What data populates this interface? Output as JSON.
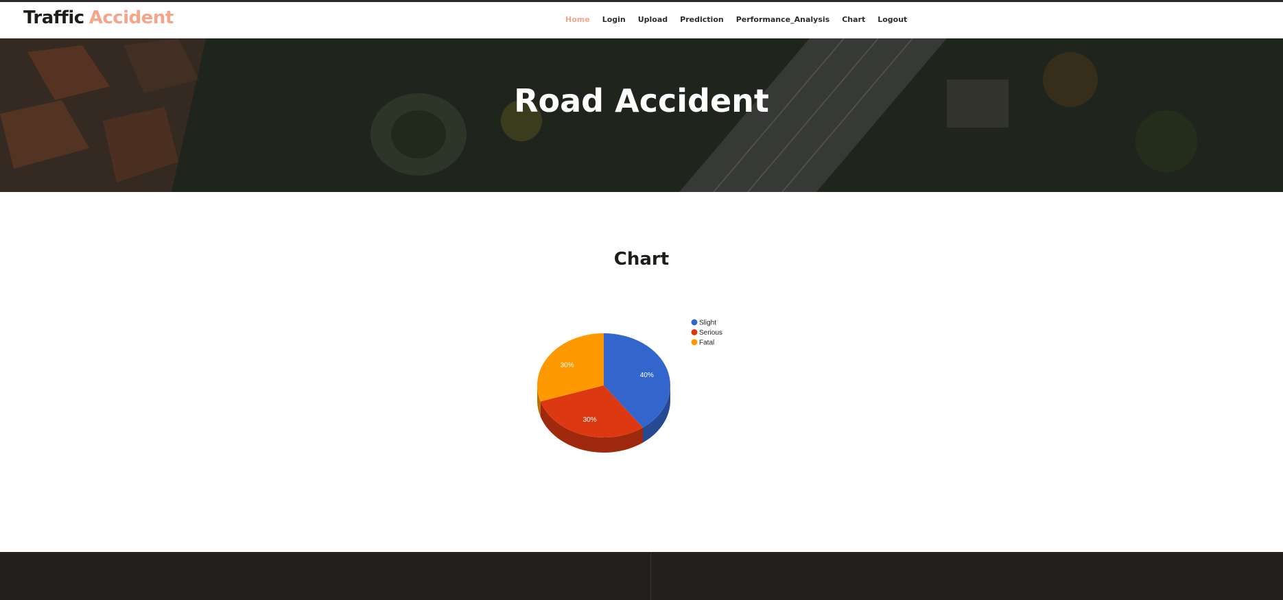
{
  "brand": {
    "first": "Traffic",
    "second": "Accident",
    "accent_color": "#f4a58a"
  },
  "nav": {
    "items": [
      {
        "label": "Home",
        "active": true
      },
      {
        "label": "Login",
        "active": false
      },
      {
        "label": "Upload",
        "active": false
      },
      {
        "label": "Prediction",
        "active": false
      },
      {
        "label": "Performance_Analysis",
        "active": false
      },
      {
        "label": "Chart",
        "active": false
      },
      {
        "label": "Logout",
        "active": false
      }
    ],
    "active_color": "#f4a58a",
    "text_color": "#2b2b2b"
  },
  "hero": {
    "title": "Road Accident",
    "background": "aerial-city-photo"
  },
  "section": {
    "title": "Chart"
  },
  "chart_data": {
    "type": "pie",
    "style": "3d",
    "categories": [
      "Slight",
      "Serious",
      "Fatal"
    ],
    "values": [
      40,
      30,
      30
    ],
    "slice_labels": [
      "40%",
      "30%",
      "30%"
    ],
    "colors": [
      "#3366cc",
      "#dc3912",
      "#ff9900"
    ],
    "legend_position": "right",
    "title": ""
  },
  "footer": {
    "background": "#221f1c"
  }
}
